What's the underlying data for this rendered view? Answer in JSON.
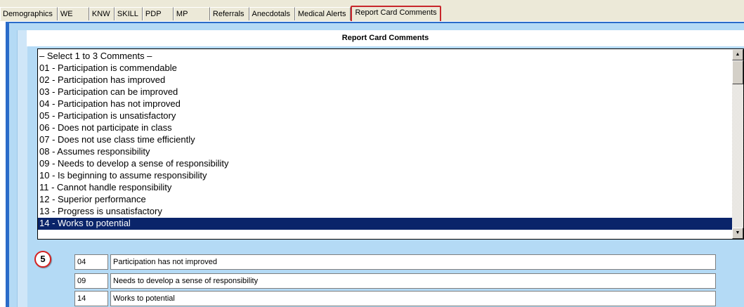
{
  "tabs": [
    {
      "label": "Demographics"
    },
    {
      "label": "WE"
    },
    {
      "label": "KNW"
    },
    {
      "label": "SKILL"
    },
    {
      "label": "PDP"
    },
    {
      "label": "MP"
    },
    {
      "label": "Referrals"
    },
    {
      "label": "Anecdotals"
    },
    {
      "label": "Medical Alerts"
    },
    {
      "label": "Report Card Comments"
    }
  ],
  "active_tab": "Report Card Comments",
  "panel": {
    "title": "Report Card Comments"
  },
  "comment_list": {
    "items": [
      "– Select 1 to 3 Comments –",
      "01 - Participation is commendable",
      "02 - Participation has improved",
      "03 - Participation can be improved",
      "04 - Participation has not improved",
      "05 - Participation is unsatisfactory",
      "06 - Does not participate in class",
      "07 - Does not use class time efficiently",
      "08 - Assumes responsibility",
      "09 - Needs to develop a sense of responsibility",
      "10 - Is beginning to assume responsibility",
      "11 - Cannot handle responsibility",
      "12 - Superior performance",
      "13 - Progress is unsatisfactory",
      "14 - Works to potential"
    ],
    "selected_index": 14,
    "scroll_up_glyph": "▲",
    "scroll_down_glyph": "▼"
  },
  "step_badge": "5",
  "selected_comments": [
    {
      "code": "04",
      "text": "Participation has not improved"
    },
    {
      "code": "09",
      "text": "Needs to develop a sense of responsibility"
    },
    {
      "code": "14",
      "text": "Works to potential"
    }
  ],
  "colors": {
    "frame_blue": "#2a6bc9",
    "panel_blue": "#b4daf5",
    "selection": "#0a246a",
    "highlight_red": "#c8262b"
  }
}
